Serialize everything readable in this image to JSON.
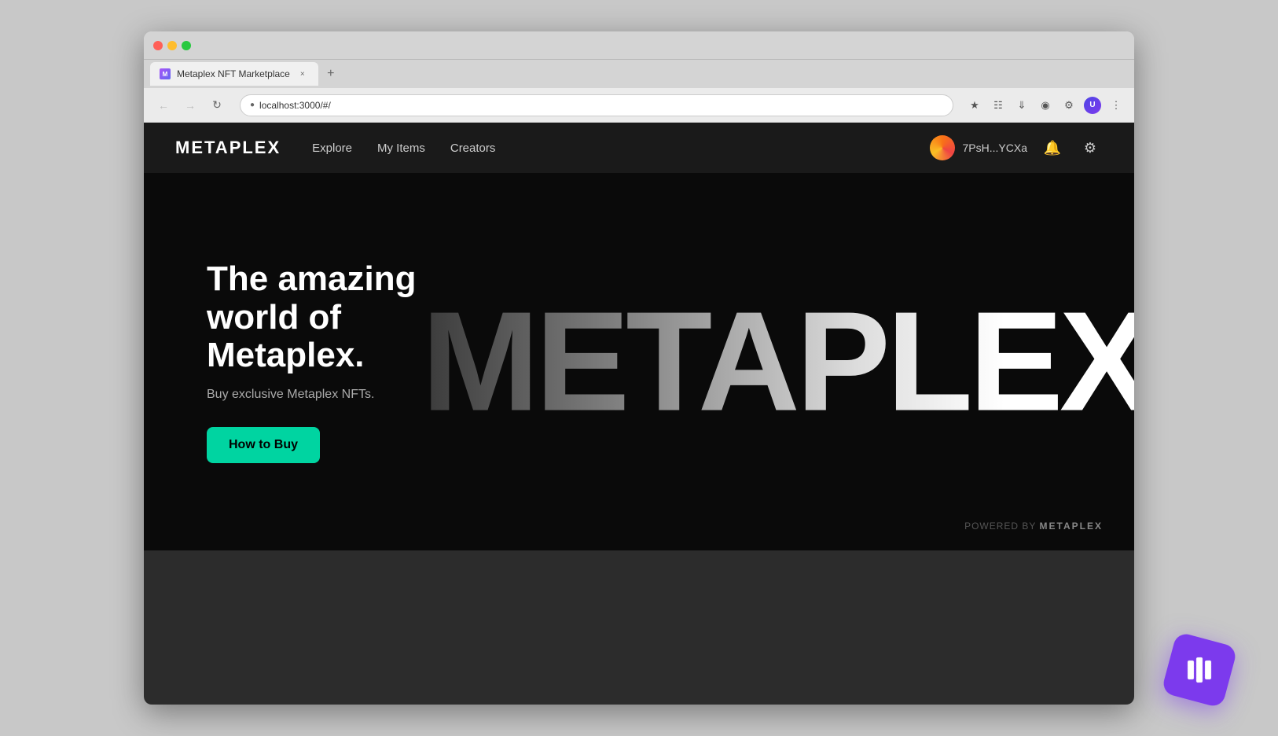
{
  "browser": {
    "tab_title": "Metaplex NFT Marketplace",
    "url": "localhost:3000/#/",
    "add_tab_label": "+",
    "tab_close_label": "×"
  },
  "nav": {
    "logo": "METAPLEX",
    "links": [
      {
        "id": "explore",
        "label": "Explore"
      },
      {
        "id": "my-items",
        "label": "My Items"
      },
      {
        "id": "creators",
        "label": "Creators"
      }
    ],
    "wallet_address": "7PsH...YCXa"
  },
  "hero": {
    "title_line1": "The amazing world of",
    "title_line2": "Metaplex.",
    "subtitle": "Buy exclusive Metaplex NFTs.",
    "cta_label": "How to Buy",
    "watermark": "METAPLEX",
    "powered_prefix": "POWERED BY",
    "powered_brand": "METAPLEX"
  }
}
